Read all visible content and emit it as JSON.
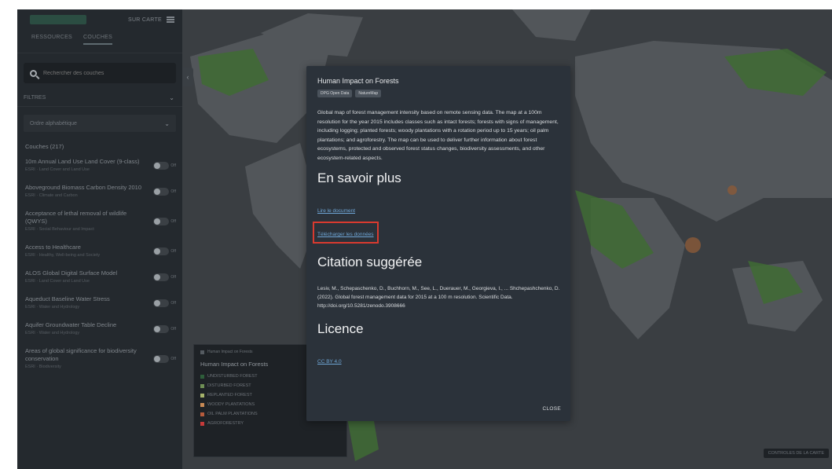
{
  "sidebar": {
    "top_right_label": "SUR CARTE",
    "tabs": [
      "RESSOURCES",
      "COUCHES"
    ],
    "search_placeholder": "Rechercher des couches",
    "filter_label": "FILTRES",
    "sort_label": "Ordre alphabétique",
    "count_label": "Couches (217)",
    "layers": [
      {
        "name": "10m Annual Land Use Land Cover (9-class)",
        "meta": "ESRI · Land Cover and Land Use"
      },
      {
        "name": "Aboveground Biomass Carbon Density 2010",
        "meta": "ESRI · Climate and Carbon"
      },
      {
        "name": "Acceptance of lethal removal of wildlife (QWYS)",
        "meta": "ESRI · Social Behaviour and Impact"
      },
      {
        "name": "Access to Healthcare",
        "meta": "ESRI · Healthy, Well-being and Society"
      },
      {
        "name": "ALOS Global Digital Surface Model",
        "meta": "ESRI · Land Cover and Land Use"
      },
      {
        "name": "Aqueduct Baseline Water Stress",
        "meta": "ESRI · Water and Hydrology"
      },
      {
        "name": "Aquifer Groundwater Table Decline",
        "meta": "ESRI · Water and Hydrology"
      },
      {
        "name": "Areas of global significance for biodiversity conservation",
        "meta": "ESRI · Biodiversity"
      }
    ],
    "toggle_label": "Off"
  },
  "legend": {
    "header": "Human Impact on Forests",
    "title": "Human Impact on Forests",
    "items": [
      {
        "label": "UNDISTURBED FOREST",
        "color": "#2e5e3a"
      },
      {
        "label": "DISTURBED FOREST",
        "color": "#6f8f55"
      },
      {
        "label": "REPLANTED FOREST",
        "color": "#a6b36b"
      },
      {
        "label": "WOODY PLANTATIONS",
        "color": "#c88a55"
      },
      {
        "label": "OIL PALM PLANTATIONS",
        "color": "#b65b3c"
      },
      {
        "label": "AGROFORESTRY",
        "color": "#c43a3a"
      }
    ]
  },
  "basemap_button": "CONTROLES DE LA CARTE",
  "modal": {
    "title": "Human Impact on Forests",
    "tags": [
      "DPG Open Data",
      "NatureMap"
    ],
    "description": "Global map of forest management intensity based on remote sensing data. The map at a 100m resolution for the year 2015 includes classes such as intact forests; forests with signs of management, including logging; planted forests; woody plantations with a rotation period up to 15 years; oil palm plantations; and agroforestry. The map can be used to deliver further information about forest ecosystems, protected and observed forest status changes, biodiversity assessments, and other ecosystem-related aspects.",
    "learn_more_heading": "En savoir plus",
    "link_document": "Lire le document",
    "link_download": "Télécharger les données",
    "citation_heading": "Citation suggérée",
    "citation": "Lesiv, M., Schepaschenko, D., Buchhorn, M., See, L., Duerauer, M., Georgieva, I., ... Shchepashchenko, D. (2022). Global forest management data for 2015 at a 100 m resolution. Scientific Data. http://doi.org/10.5281/zenodo.3908666",
    "licence_heading": "Licence",
    "licence_link": "CC BY 4.0",
    "close_label": "CLOSE"
  }
}
